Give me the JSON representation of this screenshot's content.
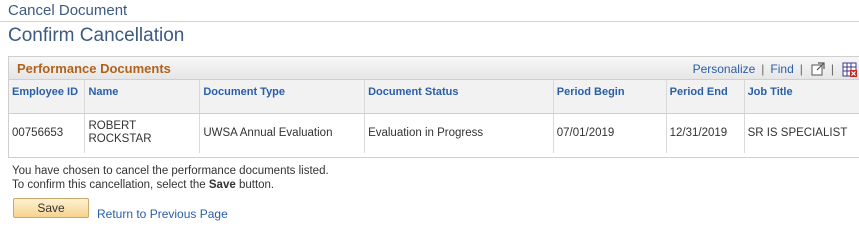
{
  "breadcrumb": {
    "label": "Cancel Document"
  },
  "page": {
    "title": "Confirm Cancellation"
  },
  "grid": {
    "title": "Performance Documents",
    "tools": {
      "personalize": "Personalize",
      "separator": "|",
      "find": "Find",
      "view_all_icon": "new-window-icon",
      "download_icon": "spreadsheet-icon"
    },
    "columns": [
      "Employee ID",
      "Name",
      "Document Type",
      "Document Status",
      "Period Begin",
      "Period End",
      "Job Title"
    ],
    "rows": [
      {
        "employee_id": "00756653",
        "name": "ROBERT ROCKSTAR",
        "document_type": "UWSA Annual Evaluation",
        "document_status": "Evaluation in Progress",
        "period_begin": "07/01/2019",
        "period_end": "12/31/2019",
        "job_title": "SR IS SPECIALIST"
      }
    ]
  },
  "message": {
    "line1": "You have chosen to cancel the performance documents listed.",
    "line2_prefix": "To confirm this cancellation, select the",
    "line2_bold": "Save",
    "line2_suffix": "button."
  },
  "actions": {
    "save_label": "Save",
    "return_label": "Return to Previous Page"
  },
  "colors": {
    "title_blue": "#3d5a80",
    "link_blue": "#2a5ea8",
    "grid_title_orange": "#b0631c",
    "button_gold": "#f5d38e"
  }
}
